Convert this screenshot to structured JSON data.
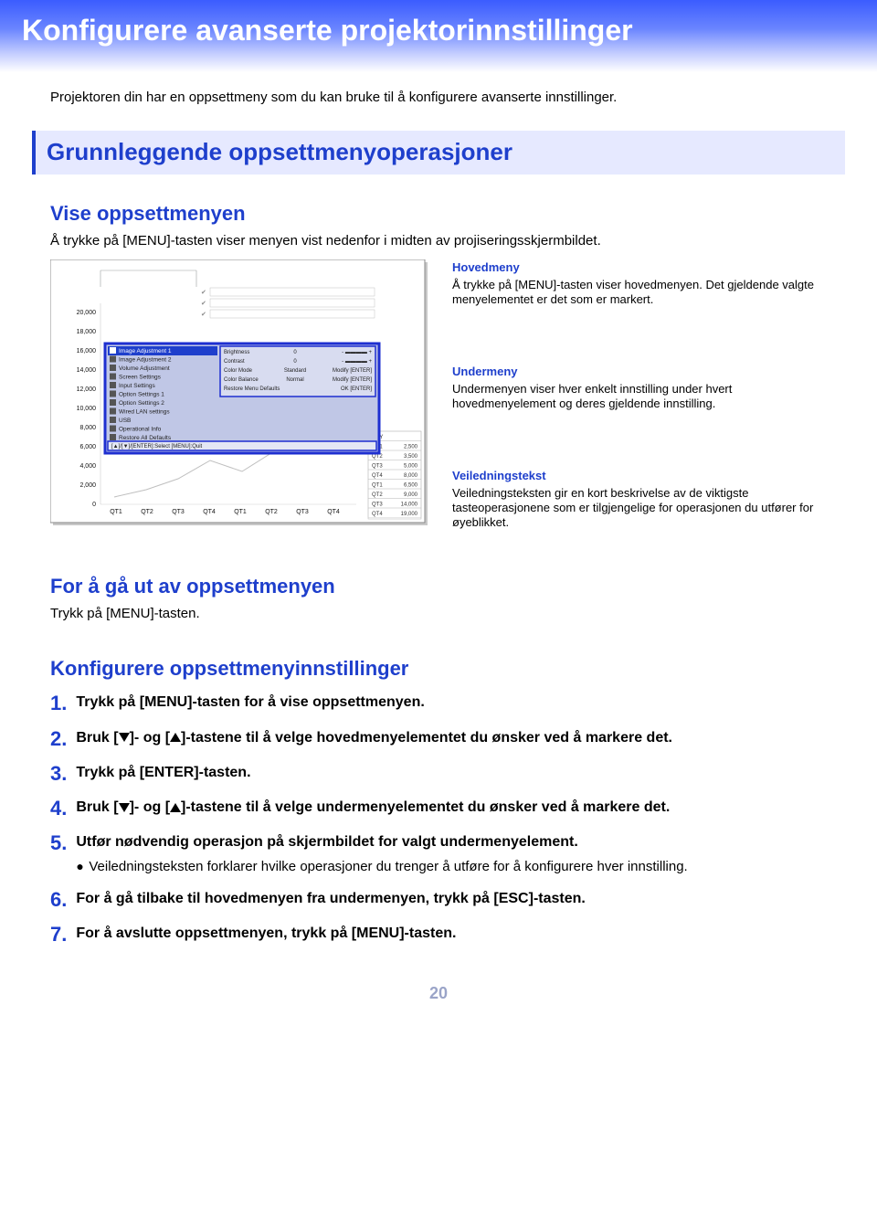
{
  "title_banner": "Konfigurere avanserte projektorinnstillinger",
  "intro": "Projektoren din har en oppsettmeny som du kan bruke til å konfigurere avanserte innstillinger.",
  "section_bar": "Grunnleggende oppsettmenyoperasjoner",
  "vise": {
    "heading": "Vise oppsettmenyen",
    "body": "Å trykke på [MENU]-tasten viser menyen vist nedenfor i midten av projiseringsskjermbildet."
  },
  "notes": {
    "hovedmeny": {
      "title": "Hovedmeny",
      "body": "Å trykke på [MENU]-tasten viser hovedmenyen. Det gjeldende valgte menyelementet er det som er markert."
    },
    "undermeny": {
      "title": "Undermeny",
      "body": "Undermenyen viser hver enkelt innstilling under hvert hovedmenyelement og deres gjeldende innstilling."
    },
    "veiledning": {
      "title": "Veiledningstekst",
      "body": "Veiledningsteksten gir en kort beskrivelse av de viktigste tasteoperasjonene som er tilgjengelige for operasjonen du utfører for øyeblikket."
    }
  },
  "exit": {
    "heading": "For å gå ut av oppsettmenyen",
    "body": "Trykk på [MENU]-tasten."
  },
  "konfig": {
    "heading": "Konfigurere oppsettmenyinnstillinger",
    "steps": [
      {
        "num": "1.",
        "text": "Trykk på [MENU]-tasten for å vise oppsettmenyen."
      },
      {
        "num": "2.",
        "parts": [
          "Bruk [",
          "]- og [",
          "]-tastene til å velge hovedmenyelementet du ønsker ved å markere det."
        ]
      },
      {
        "num": "3.",
        "text": "Trykk på [ENTER]-tasten."
      },
      {
        "num": "4.",
        "parts": [
          "Bruk [",
          "]- og [",
          "]-tastene til å velge undermenyelementet du ønsker ved å markere det."
        ]
      },
      {
        "num": "5.",
        "text": "Utfør nødvendig operasjon på skjermbildet for valgt undermenyelement.",
        "bullet": "Veiledningsteksten forklarer hvilke operasjoner du trenger å utføre for å konfigurere hver innstilling."
      },
      {
        "num": "6.",
        "text": "For å gå tilbake til hovedmenyen fra undermenyen, trykk på [ESC]-tasten."
      },
      {
        "num": "7.",
        "text": "For å avslutte oppsettmenyen, trykk på [MENU]-tasten."
      }
    ]
  },
  "diagram": {
    "menu_items": [
      "Image Adjustment 1",
      "Image Adjustment 2",
      "Volume Adjustment",
      "Screen Settings",
      "Input Settings",
      "Option Settings 1",
      "Option Settings 2",
      "Wired LAN settings",
      "USB",
      "Operational Info",
      "Restore All Defaults"
    ],
    "submenu": [
      {
        "label": "Brightness",
        "col2": "0",
        "col3": "- ▬▬▬▬ +"
      },
      {
        "label": "Contrast",
        "col2": "0",
        "col3": "- ▬▬▬▬ +"
      },
      {
        "label": "Color Mode",
        "col2": "Standard",
        "col3": "Modify [ENTER]"
      },
      {
        "label": "Color Balance",
        "col2": "Normal",
        "col3": "Modify [ENTER]"
      },
      {
        "label": "Restore Menu Defaults",
        "col2": "",
        "col3": "OK [ENTER]"
      }
    ],
    "guidance": "[▲]/[▼]/[ENTER]:Select [MENU]:Quit",
    "ylabels": [
      "20,000",
      "18,000",
      "16,000",
      "14,000",
      "12,000",
      "10,000",
      "8,000",
      "6,000",
      "4,000",
      "2,000",
      "0"
    ],
    "xlabels": [
      "QT1",
      "QT2",
      "QT3",
      "QT4",
      "QT1",
      "QT2",
      "QT3",
      "QT4"
    ],
    "qty_rows": [
      [
        "QTY",
        ""
      ],
      [
        "QT1",
        "2,500"
      ],
      [
        "QT2",
        "3,500"
      ],
      [
        "QT3",
        "5,000"
      ],
      [
        "QT4",
        "8,000"
      ],
      [
        "QT1",
        "6,500"
      ],
      [
        "QT2",
        "9,000"
      ],
      [
        "QT3",
        "14,000"
      ],
      [
        "QT4",
        "19,000"
      ]
    ]
  },
  "page_number": "20"
}
